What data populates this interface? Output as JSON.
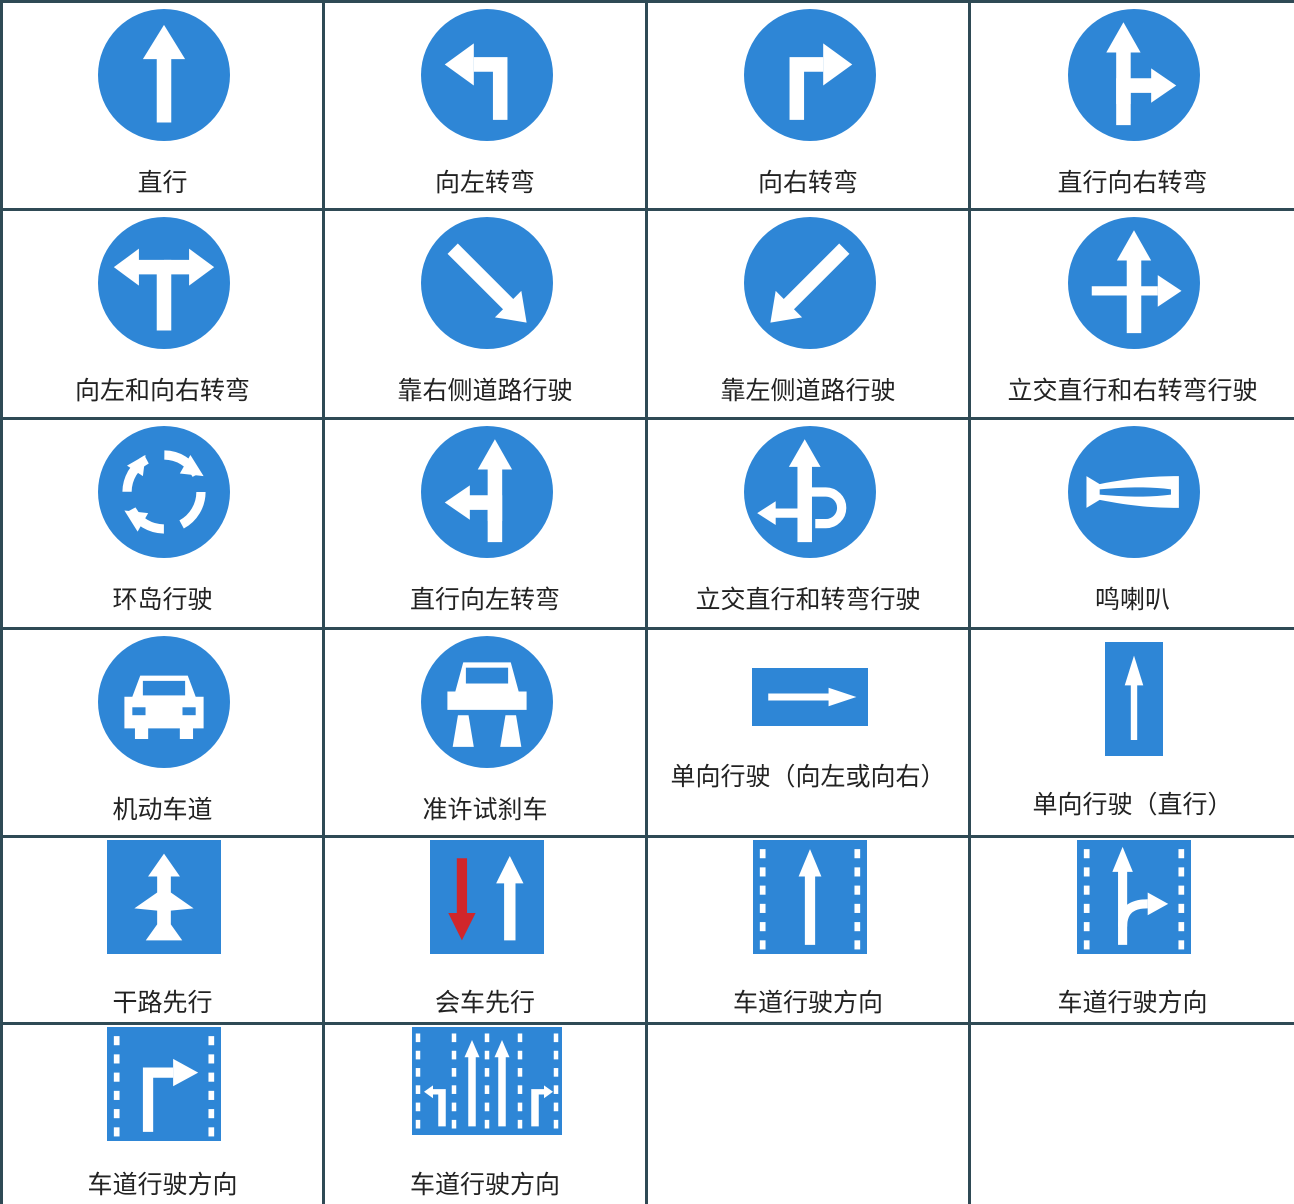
{
  "colors": {
    "sign_blue": "#2e86d6",
    "border": "#2f4a55",
    "arrow_red": "#d0262b"
  },
  "signs": [
    {
      "label": "直行",
      "shape": "circle",
      "icon": "arrow-up-icon"
    },
    {
      "label": "向左转弯",
      "shape": "circle",
      "icon": "turn-left-icon"
    },
    {
      "label": "向右转弯",
      "shape": "circle",
      "icon": "turn-right-icon"
    },
    {
      "label": "直行向右转弯",
      "shape": "circle",
      "icon": "straight-or-right-icon"
    },
    {
      "label": "向左和向右转弯",
      "shape": "circle",
      "icon": "left-and-right-icon"
    },
    {
      "label": "靠右侧道路行驶",
      "shape": "circle",
      "icon": "keep-right-icon"
    },
    {
      "label": "靠左侧道路行驶",
      "shape": "circle",
      "icon": "keep-left-icon"
    },
    {
      "label": "立交直行和右转弯行驶",
      "shape": "circle",
      "icon": "interchange-straight-right-icon"
    },
    {
      "label": "环岛行驶",
      "shape": "circle",
      "icon": "roundabout-icon"
    },
    {
      "label": "直行向左转弯",
      "shape": "circle",
      "icon": "straight-or-left-icon"
    },
    {
      "label": "立交直行和转弯行驶",
      "shape": "circle",
      "icon": "interchange-straight-turn-icon"
    },
    {
      "label": "鸣喇叭",
      "shape": "circle",
      "icon": "horn-icon"
    },
    {
      "label": "机动车道",
      "shape": "circle",
      "icon": "car-icon"
    },
    {
      "label": "准许试刹车",
      "shape": "circle",
      "icon": "brake-test-icon"
    },
    {
      "label": "单向行驶（向左或向右）",
      "shape": "wide-rect",
      "icon": "arrow-right-icon"
    },
    {
      "label": "单向行驶（直行）",
      "shape": "tall-rect",
      "icon": "arrow-up-icon"
    },
    {
      "label": "干路先行",
      "shape": "square",
      "icon": "priority-road-icon"
    },
    {
      "label": "会车先行",
      "shape": "square",
      "icon": "priority-oncoming-icon"
    },
    {
      "label": "车道行驶方向",
      "shape": "square",
      "icon": "lane-straight-icon"
    },
    {
      "label": "车道行驶方向",
      "shape": "square",
      "icon": "lane-straight-right-icon"
    },
    {
      "label": "车道行驶方向",
      "shape": "square",
      "icon": "lane-right-icon"
    },
    {
      "label": "车道行驶方向",
      "shape": "wide-square",
      "icon": "multi-lane-icon"
    }
  ]
}
